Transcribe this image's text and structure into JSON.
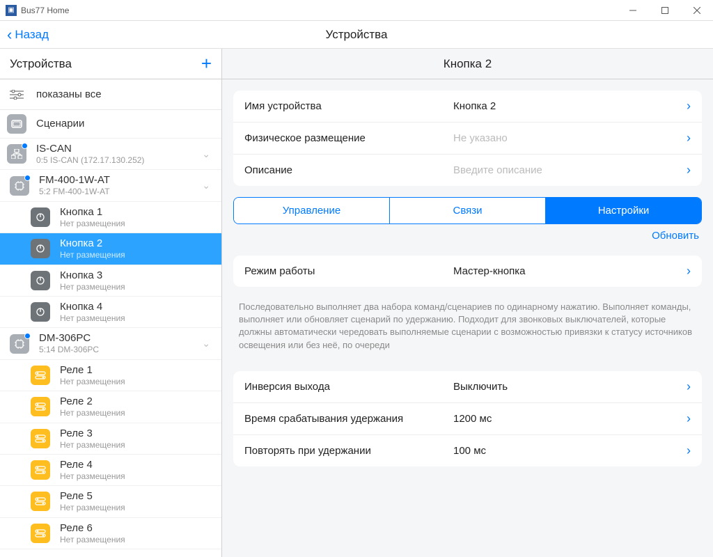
{
  "window": {
    "title": "Bus77 Home"
  },
  "topnav": {
    "back": "Назад",
    "title": "Устройства"
  },
  "sidebar": {
    "header": "Устройства",
    "filter": "показаны все",
    "scenarios": "Сценарии",
    "nodes": [
      {
        "title": "IS-CAN",
        "sub": "0:5 IS-CAN (172.17.130.252)"
      },
      {
        "title": "FM-400-1W-AT",
        "sub": "5:2 FM-400-1W-AT"
      },
      {
        "title": "DM-306PC",
        "sub": "5:14 DM-306PC"
      }
    ],
    "buttons": [
      {
        "title": "Кнопка 1",
        "sub": "Нет размещения"
      },
      {
        "title": "Кнопка 2",
        "sub": "Нет размещения"
      },
      {
        "title": "Кнопка 3",
        "sub": "Нет размещения"
      },
      {
        "title": "Кнопка 4",
        "sub": "Нет размещения"
      }
    ],
    "relays": [
      {
        "title": "Реле 1",
        "sub": "Нет размещения"
      },
      {
        "title": "Реле 2",
        "sub": "Нет размещения"
      },
      {
        "title": "Реле 3",
        "sub": "Нет размещения"
      },
      {
        "title": "Реле 4",
        "sub": "Нет размещения"
      },
      {
        "title": "Реле 5",
        "sub": "Нет размещения"
      },
      {
        "title": "Реле 6",
        "sub": "Нет размещения"
      }
    ]
  },
  "content": {
    "header": "Кнопка 2",
    "identity": {
      "name_label": "Имя устройства",
      "name_value": "Кнопка 2",
      "loc_label": "Физическое размещение",
      "loc_value": "Не указано",
      "desc_label": "Описание",
      "desc_value": "Введите описание"
    },
    "tabs": {
      "control": "Управление",
      "links": "Связи",
      "settings": "Настройки"
    },
    "refresh": "Обновить",
    "mode": {
      "label": "Режим работы",
      "value": "Мастер-кнопка"
    },
    "mode_desc": "Последовательно выполняет два набора команд/сценариев по одинарному нажатию. Выполняет команды, выполняет или обновляет сценарий по удержанию. Подходит для звонковых выключателей, которые должны автоматически чередовать выполняемые сценарии с возможностью привязки к статусу источников освещения или без неё, по очереди",
    "params": {
      "inv_label": "Инверсия выхода",
      "inv_value": "Выключить",
      "hold_label": "Время срабатывания удержания",
      "hold_value": "1200 мс",
      "repeat_label": "Повторять при удержании",
      "repeat_value": "100 мс"
    }
  }
}
